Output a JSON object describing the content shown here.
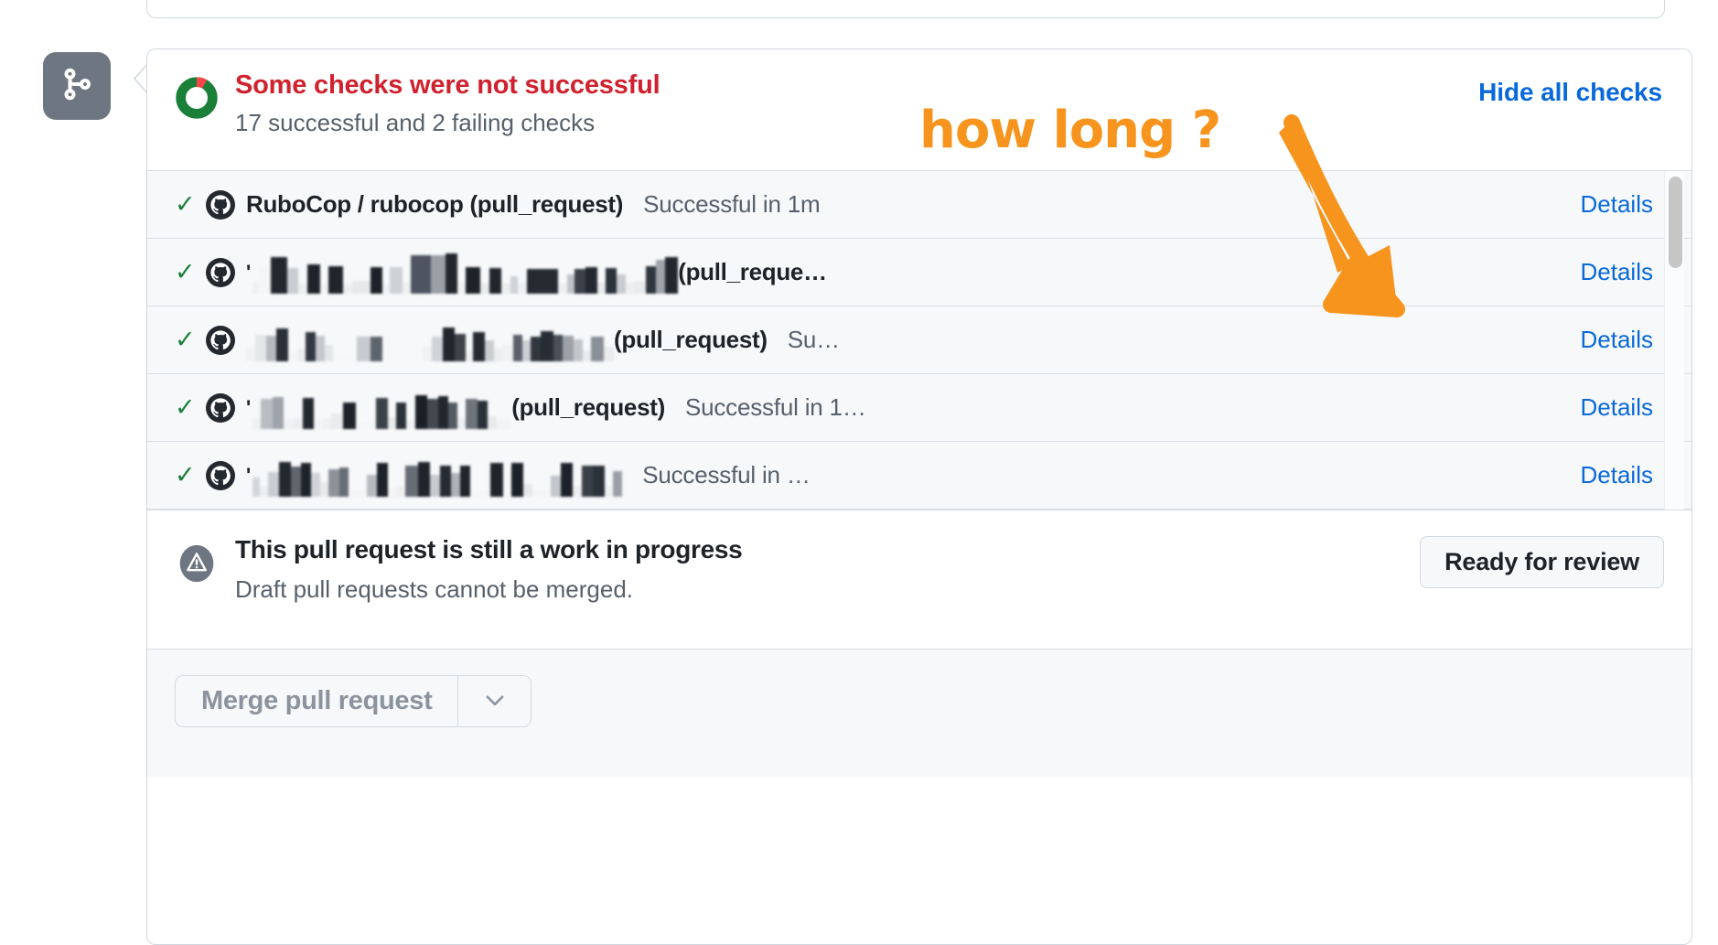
{
  "timeline": {
    "badge_icon": "git-branch-icon"
  },
  "checks": {
    "status_icon": "progress-donut-icon",
    "title": "Some checks were not successful",
    "subtitle": "17 successful and 2 failing checks",
    "hide_all_label": "Hide all checks",
    "successful_count": 17,
    "failing_count": 2,
    "rows": [
      {
        "state_icon": "check-icon",
        "app_icon": "github-actions-icon",
        "name": "RuboCop / rubocop (pull_request)",
        "name_redacted": false,
        "status": "Successful in 1m",
        "details_label": "Details"
      },
      {
        "state_icon": "check-icon",
        "app_icon": "github-actions-icon",
        "name": "(pull_reque…",
        "name_redacted": true,
        "status": "",
        "details_label": "Details"
      },
      {
        "state_icon": "check-icon",
        "app_icon": "github-actions-icon",
        "name": "(pull_request)",
        "name_redacted": true,
        "status": "Su…",
        "details_label": "Details"
      },
      {
        "state_icon": "check-icon",
        "app_icon": "github-actions-icon",
        "name": "(pull_request)",
        "name_redacted": true,
        "status": "Successful in 1…",
        "details_label": "Details"
      },
      {
        "state_icon": "check-icon",
        "app_icon": "github-actions-icon",
        "name": "",
        "name_redacted": true,
        "status": "Successful in …",
        "details_label": "Details"
      }
    ]
  },
  "wip": {
    "icon": "alert-circle-icon",
    "title": "This pull request is still a work in progress",
    "subtitle": "Draft pull requests cannot be merged.",
    "button_label": "Ready for review"
  },
  "merge": {
    "button_label": "Merge pull request",
    "dropdown_icon": "chevron-down-icon"
  },
  "annotation": {
    "text": "how long ?",
    "color": "#f7941d",
    "arrow_icon": "arrow-down-right-icon"
  },
  "colors": {
    "danger": "#cf222e",
    "success": "#1a7f37",
    "link": "#0969da",
    "muted": "#57606a",
    "border": "#d0d7de",
    "row_bg": "#f6f8fa",
    "annotation": "#f7941d"
  }
}
